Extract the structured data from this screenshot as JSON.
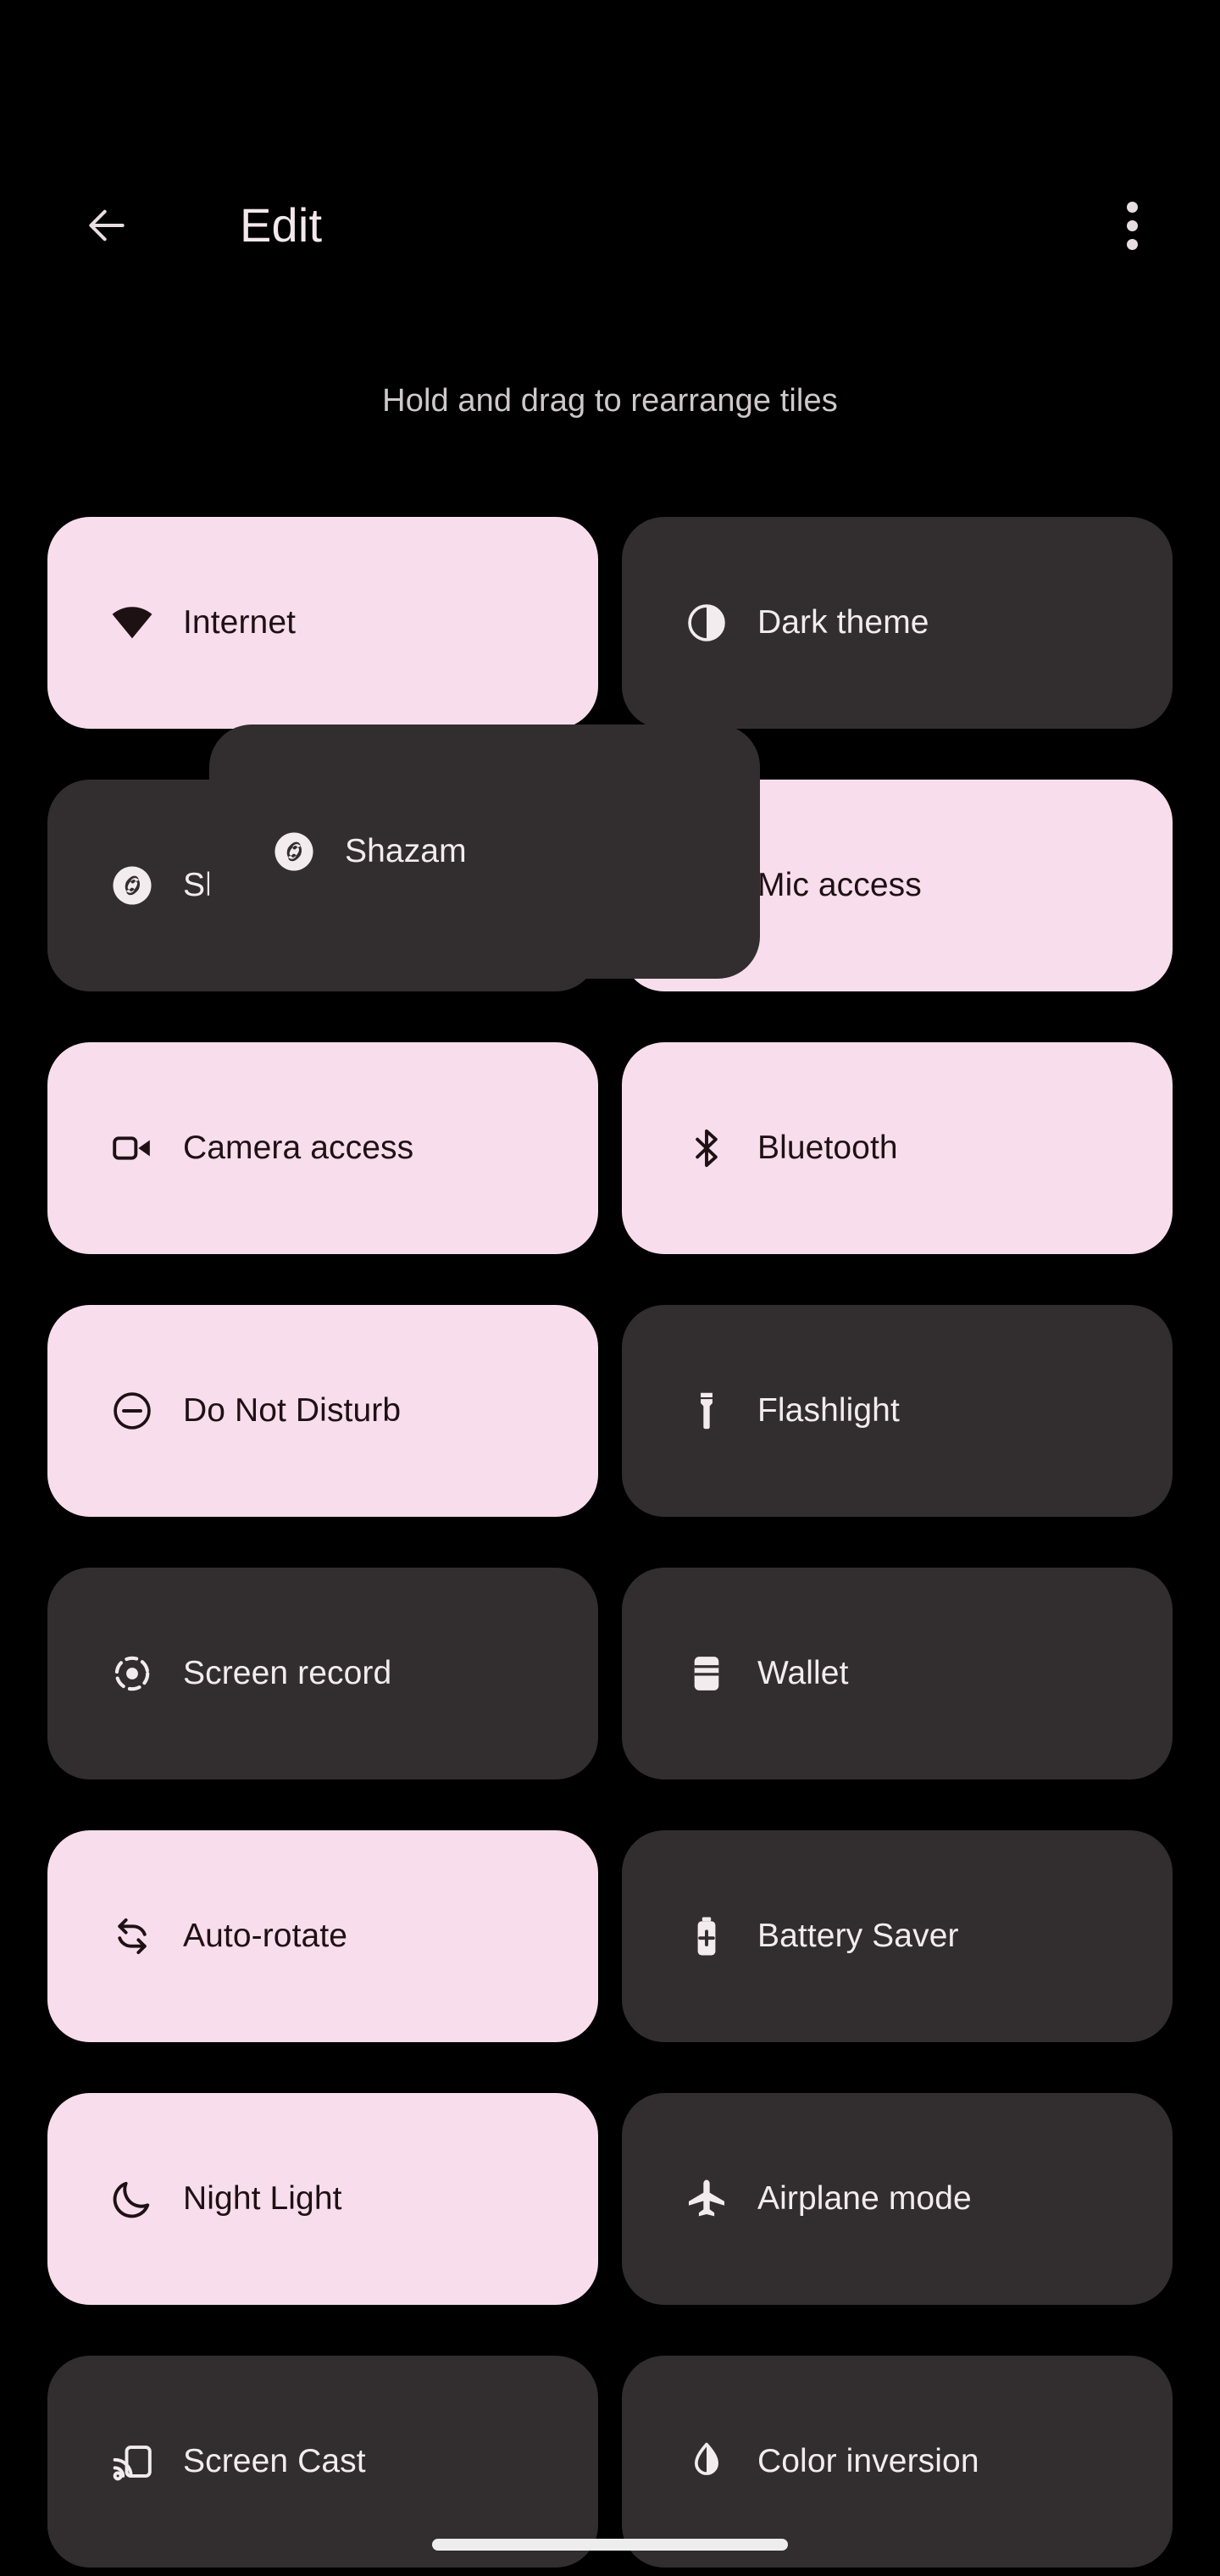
{
  "header": {
    "title": "Edit",
    "back_icon": "arrow-left-icon",
    "overflow_icon": "more-vertical-icon"
  },
  "subtitle": "Hold and drag to rearrange tiles",
  "colors": {
    "background": "#000000",
    "tile_active_bg": "#F8DDEC",
    "tile_active_fg": "#1E1114",
    "tile_inactive_bg": "#322E2F",
    "tile_inactive_fg": "#F2ECEE",
    "title_fg": "#F3E8EC",
    "subtitle_fg": "#CFC8CB",
    "home_indicator": "#EDEDED"
  },
  "dragged_tile": {
    "label": "Shazam",
    "icon": "shazam-icon",
    "state": "inactive",
    "is_dragging": true
  },
  "tiles": [
    {
      "label": "Internet",
      "icon": "wifi-icon",
      "state": "active"
    },
    {
      "label": "Dark theme",
      "icon": "dark-theme-icon",
      "state": "inactive"
    },
    {
      "label": "Shazam",
      "icon": "shazam-icon",
      "state": "inactive"
    },
    {
      "label": "Mic access",
      "icon": "mic-icon",
      "state": "active"
    },
    {
      "label": "Camera access",
      "icon": "camera-icon",
      "state": "active"
    },
    {
      "label": "Bluetooth",
      "icon": "bluetooth-icon",
      "state": "active"
    },
    {
      "label": "Do Not Disturb",
      "icon": "do-not-disturb-icon",
      "state": "active"
    },
    {
      "label": "Flashlight",
      "icon": "flashlight-icon",
      "state": "inactive"
    },
    {
      "label": "Screen record",
      "icon": "screen-record-icon",
      "state": "inactive"
    },
    {
      "label": "Wallet",
      "icon": "wallet-icon",
      "state": "inactive"
    },
    {
      "label": "Auto-rotate",
      "icon": "auto-rotate-icon",
      "state": "active"
    },
    {
      "label": "Battery Saver",
      "icon": "battery-saver-icon",
      "state": "inactive"
    },
    {
      "label": "Night Light",
      "icon": "night-light-icon",
      "state": "active"
    },
    {
      "label": "Airplane mode",
      "icon": "airplane-icon",
      "state": "inactive"
    },
    {
      "label": "Screen Cast",
      "icon": "screen-cast-icon",
      "state": "inactive"
    },
    {
      "label": "Color inversion",
      "icon": "color-inversion-icon",
      "state": "inactive"
    }
  ]
}
